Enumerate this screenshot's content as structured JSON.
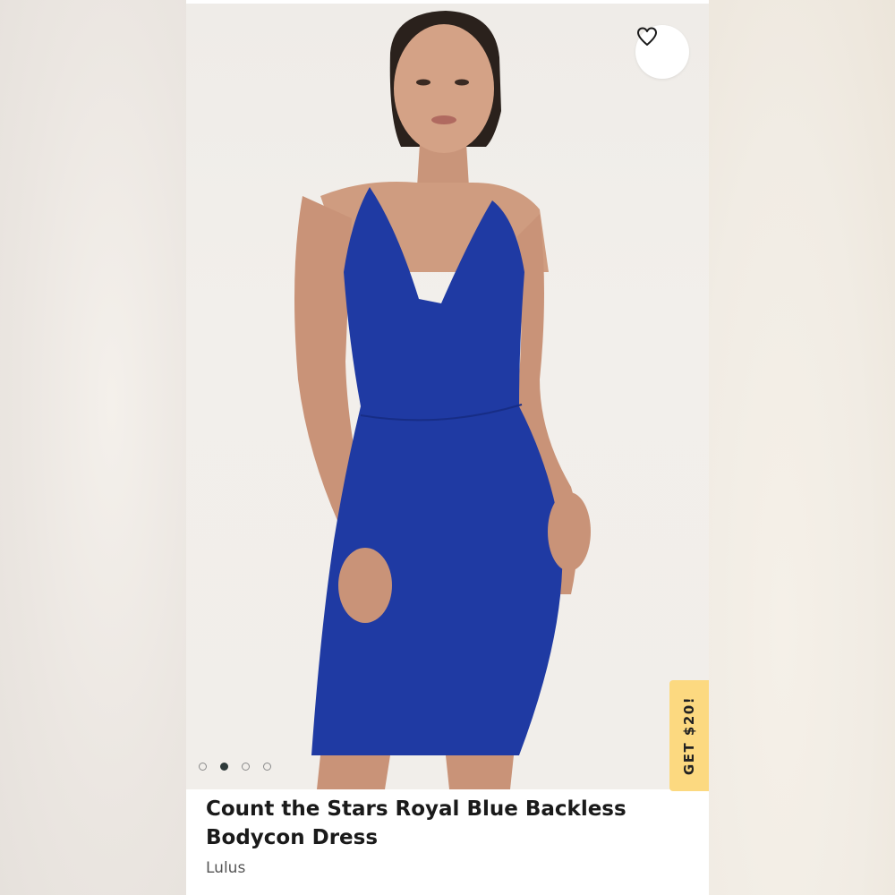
{
  "listing": {
    "title": "Count the Stars Royal Blue Backless Bodycon Dress",
    "brand": "Lulus",
    "promo_label": "GET $20!",
    "like_icon": "heart-outline-icon",
    "carousel": {
      "total": 4,
      "active_index": 1
    }
  },
  "colors": {
    "dress": "#1f3aa3",
    "promo": "#fcd980",
    "title": "#1a1a1a"
  }
}
